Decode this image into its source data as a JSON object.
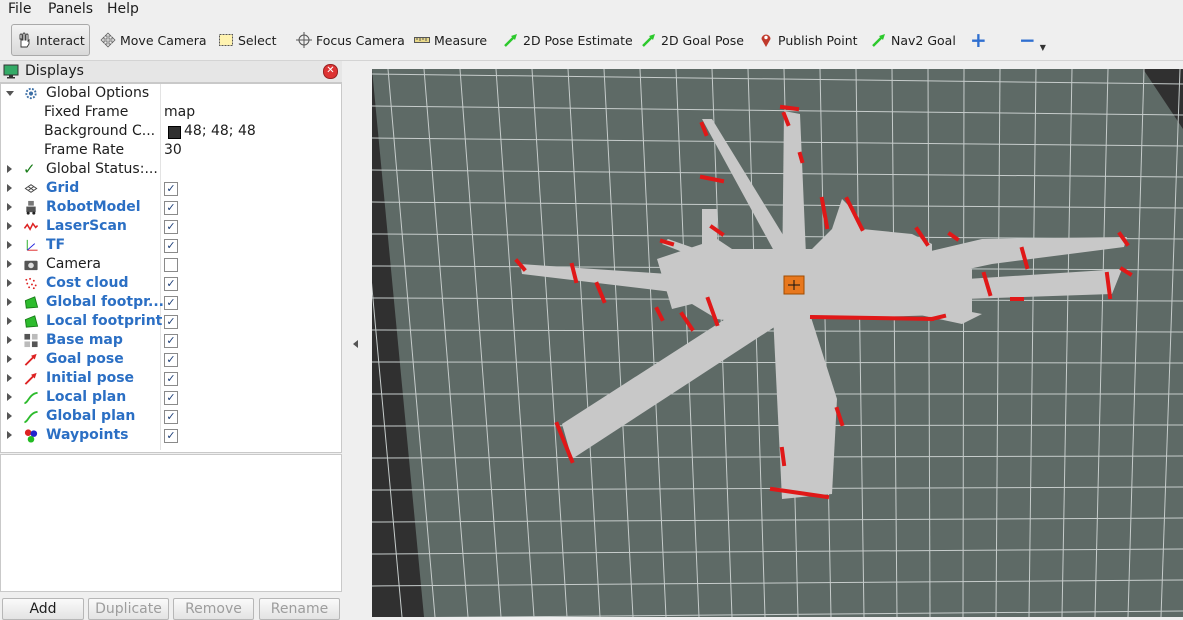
{
  "menu": {
    "file": "File",
    "panels": "Panels",
    "help": "Help"
  },
  "toolbar": {
    "interact": "Interact",
    "move_camera": "Move Camera",
    "select": "Select",
    "focus_camera": "Focus Camera",
    "measure": "Measure",
    "pose_estimate": "2D Pose Estimate",
    "goal_pose": "2D Goal Pose",
    "publish_point": "Publish Point",
    "nav2_goal": "Nav2 Goal",
    "add_tool": "+",
    "remove_tool": "−"
  },
  "displays": {
    "title": "Displays",
    "global_options": "Global Options",
    "fixed_frame_label": "Fixed Frame",
    "fixed_frame_value": "map",
    "background_label": "Background C...",
    "background_value": "48; 48; 48",
    "background_color": "#303030",
    "frame_rate_label": "Frame Rate",
    "frame_rate_value": "30",
    "global_status": "Global Status:...",
    "items": [
      {
        "label": "Grid",
        "checked": true,
        "icon": "grid-icon"
      },
      {
        "label": "RobotModel",
        "checked": true,
        "icon": "robot-icon"
      },
      {
        "label": "LaserScan",
        "checked": true,
        "icon": "laser-icon"
      },
      {
        "label": "TF",
        "checked": true,
        "icon": "axes-icon"
      },
      {
        "label": "Camera",
        "checked": false,
        "icon": "camera-icon"
      },
      {
        "label": "Cost cloud",
        "checked": true,
        "icon": "pointcloud-icon"
      },
      {
        "label": "Global footpr...",
        "checked": true,
        "icon": "polygon-icon"
      },
      {
        "label": "Local footprint",
        "checked": true,
        "icon": "polygon-icon"
      },
      {
        "label": "Base map",
        "checked": true,
        "icon": "map-icon"
      },
      {
        "label": "Goal pose",
        "checked": true,
        "icon": "pose-arrow-icon"
      },
      {
        "label": "Initial pose",
        "checked": true,
        "icon": "pose-arrow-icon"
      },
      {
        "label": "Local plan",
        "checked": true,
        "icon": "path-icon"
      },
      {
        "label": "Global plan",
        "checked": true,
        "icon": "path-icon"
      },
      {
        "label": "Waypoints",
        "checked": true,
        "icon": "markers-icon"
      }
    ],
    "buttons": {
      "add": "Add",
      "duplicate": "Duplicate",
      "remove": "Remove",
      "rename": "Rename"
    }
  },
  "colors": {
    "grid_floor": "#5e6a66",
    "map_free": "#c8c8c8",
    "obstacle": "#e01818",
    "robot": "#e8781e"
  }
}
